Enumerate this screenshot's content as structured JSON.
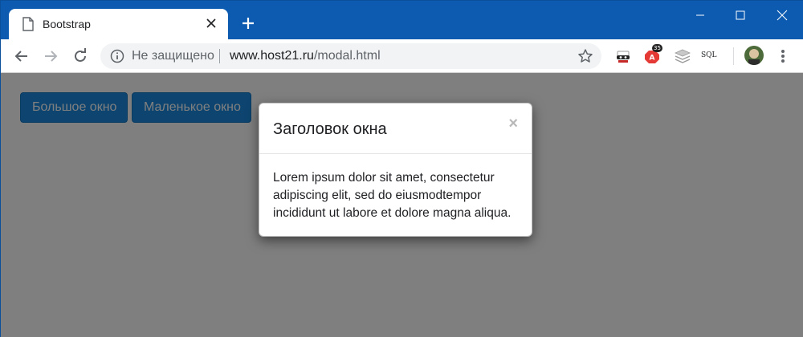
{
  "browser": {
    "tab": {
      "title": "Bootstrap"
    },
    "omnibox": {
      "security_label": "Не защищено",
      "url_host": "www.host21.ru",
      "url_path": "/modal.html"
    },
    "extensions": {
      "sql_label": "SQL",
      "adblock_badge": "35"
    }
  },
  "page": {
    "buttons": {
      "large_label": "Большое окно",
      "small_label": "Маленькое окно"
    },
    "modal": {
      "title": "Заголовок окна",
      "close_label": "×",
      "body_text": "Lorem ipsum dolor sit amet, consectetur adipiscing elit, sed do eiusmodtempor incididunt ut labore et dolore magna aliqua."
    }
  },
  "colors": {
    "chrome_frame": "#0d5bb0",
    "button_primary": "#1a8ae0",
    "backdrop": "rgba(0,0,0,0.5)"
  }
}
